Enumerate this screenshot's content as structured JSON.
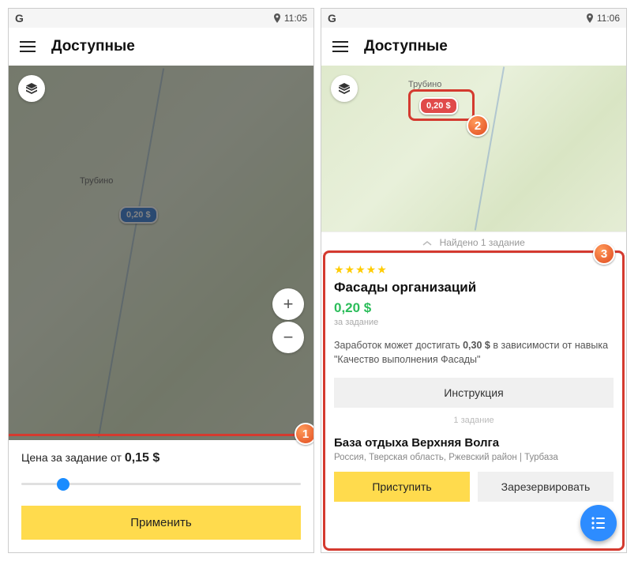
{
  "left": {
    "status": {
      "os": "G",
      "time": "11:05"
    },
    "header": {
      "title": "Доступные"
    },
    "map": {
      "town": "Трубино",
      "pin_price": "0,20 $"
    },
    "sheet": {
      "price_label_prefix": "Цена за задание от ",
      "price_value": "0,15 $",
      "apply_label": "Применить"
    }
  },
  "right": {
    "status": {
      "os": "G",
      "time": "11:06"
    },
    "header": {
      "title": "Доступные"
    },
    "map": {
      "town": "Трубино",
      "pin_price": "0,20 $"
    },
    "found_label": "Найдено 1 задание",
    "card": {
      "stars": "★★★★★",
      "title": "Фасады организаций",
      "price": "0,20 $",
      "per": "за задание",
      "desc_prefix": "Заработок может достигать ",
      "desc_bold": "0,30 $",
      "desc_suffix": " в зависимости от навыка \"Качество выполнения Фасады\"",
      "instruction_label": "Инструкция",
      "task_count": "1 задание",
      "place_title": "База отдыха Верхняя Волга",
      "place_sub": "Россия, Тверская область, Ржевский район | Турбаза",
      "start_label": "Приступить",
      "reserve_label": "Зарезервировать"
    }
  },
  "callouts": {
    "c1": "1",
    "c2": "2",
    "c3": "3"
  }
}
